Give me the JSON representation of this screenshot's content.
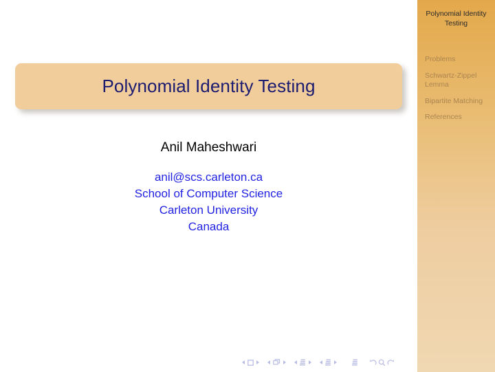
{
  "presentation": {
    "title": "Polynomial Identity Testing",
    "author": "Anil Maheshwari",
    "contact": [
      "anil@scs.carleton.ca",
      "School of Computer Science",
      "Carleton University",
      "Canada"
    ]
  },
  "sidebar": {
    "title": "Polynomial Identity Testing",
    "items": [
      {
        "label": "Problems"
      },
      {
        "label": "Schwartz-Zippel Lemma"
      },
      {
        "label": "Bipartite Matching"
      },
      {
        "label": "References"
      }
    ]
  },
  "navbar": {
    "groups": [
      {
        "prev": "prev-slide",
        "symbol": "slide-icon",
        "next": "next-slide"
      },
      {
        "prev": "prev-frame",
        "symbol": "frame-icon",
        "next": "next-frame"
      },
      {
        "prev": "prev-subsection",
        "symbol": "subsection-icon",
        "next": "next-subsection"
      },
      {
        "prev": "prev-section",
        "symbol": "section-icon",
        "next": "next-section"
      }
    ],
    "extra": "document-icon",
    "tools": [
      "back-arrow-icon",
      "magnifier-icon",
      "forward-arrow-icon"
    ]
  },
  "colors": {
    "sidebar_top": "#e3a84a",
    "sidebar_bottom": "#f0d8b2",
    "title_box": "#f2cd9c",
    "title_text": "#1b1b70",
    "contact_text": "#2222e2",
    "sidebar_item_text": "#ab8550",
    "navbar": "#b9bde4",
    "background": "#ffffff"
  }
}
